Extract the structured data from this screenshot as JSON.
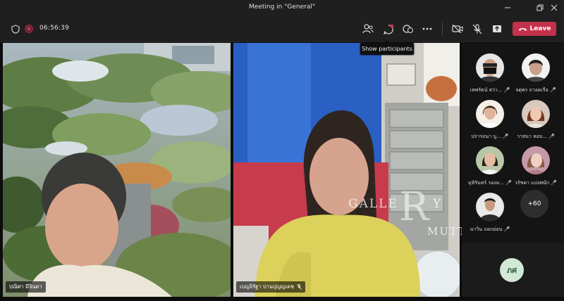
{
  "window": {
    "title": "Meeting in \"General\"",
    "minimize_icon": "minimize-icon",
    "maximize_icon": "restore-icon",
    "close_icon": "close-icon"
  },
  "toolbar": {
    "timer": "06:56:39",
    "leave_label": "Leave",
    "tooltip": "Show participants"
  },
  "colors": {
    "leave": "#c4314b",
    "background": "#1f1f1f",
    "panel": "#141414"
  },
  "tiles": [
    {
      "name": "ปณิศา มีจินดา"
    },
    {
      "name": "เบญจิรัฐา ปานปุญญเดช"
    }
  ],
  "participants": [
    {
      "name": "เทพรัตน์ สว่า..."
    },
    {
      "name": "จตุพร ถาอดเรือ"
    },
    {
      "name": "ปรารถนา บู..."
    },
    {
      "name": "วาสนา หอบ..."
    },
    {
      "name": "มุทิรันทร์ รองม..."
    },
    {
      "name": "วรัชคา แบ่งพนัก"
    },
    {
      "name": "นาวิน แยกอ่อน"
    }
  ],
  "more_count": "+60",
  "self_initials": "ภศ",
  "watermark": {
    "top": "GALLE",
    "letter": "R",
    "mid": "Y",
    "bottom": "MUTT"
  }
}
